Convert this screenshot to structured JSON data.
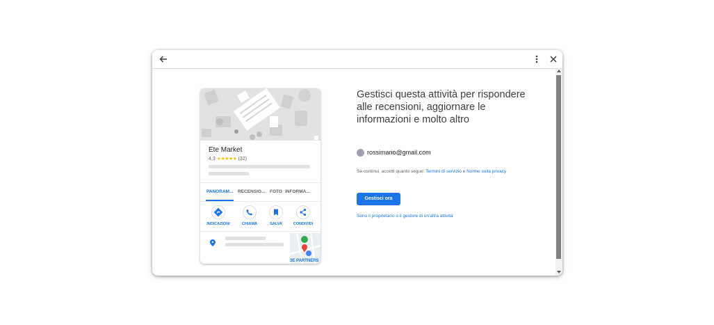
{
  "card": {
    "business_name": "Ete Market",
    "rating": "4,3",
    "stars": "★★★★★",
    "review_count": "(32)",
    "tabs": [
      "PANORAM...",
      "RECENSIO...",
      "FOTO",
      "INFORMA..."
    ],
    "actions": [
      "INDICAZIONI",
      "CHIAMA",
      "SALVA",
      "CONDIVIDI"
    ],
    "map_label": "3E PARTNERS"
  },
  "main": {
    "heading": "Gestisci questa attività per rispondere alle recensioni, aggiornare le informazioni e molto altro",
    "email": "rossimario@gmail.com",
    "terms_prefix": "Se continui, accetti quanto segue: ",
    "terms_link": "Termini di servizio",
    "terms_and": " e ",
    "privacy_link": "Norme sulla privacy",
    "cta_label": "Gestisci ora",
    "other_link": "Sono il proprietario o il gestore di un'altra attività"
  },
  "colors": {
    "accent": "#1a73e8",
    "star": "#fbbc04",
    "scroll_thumb": "#7f7f7f",
    "avatar": "#a39fac"
  },
  "icons": [
    "back-arrow-icon",
    "more-vert-icon",
    "close-icon",
    "directions-icon",
    "phone-icon",
    "bookmark-icon",
    "share-icon",
    "location-pin-icon"
  ]
}
